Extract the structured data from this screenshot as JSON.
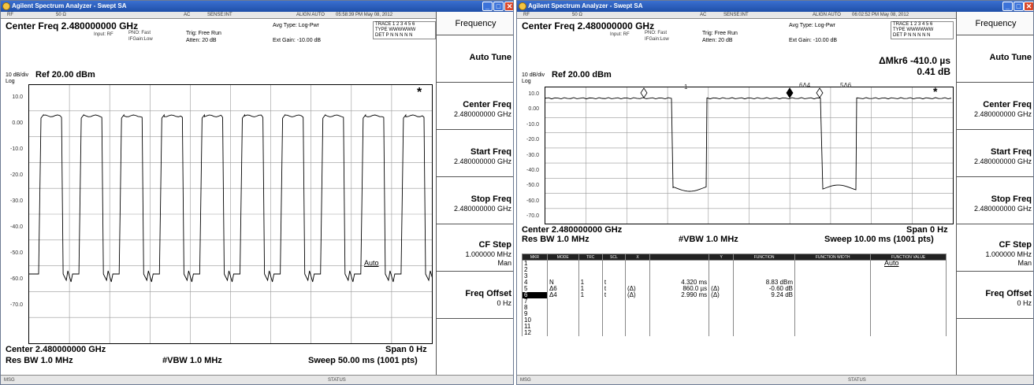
{
  "window_title": "Agilent Spectrum Analyzer - Swept SA",
  "left": {
    "info": {
      "rf": "RF",
      "ohm": "50 Ω",
      "ac": "AC",
      "sense": "SENSE:INT",
      "align": "ALIGN AUTO",
      "time": "05:58:39 PM May 08, 2012"
    },
    "center_freq": "Center Freq  2.480000000 GHz",
    "input": "Input: RF",
    "pno": "PNO: Fast",
    "ifgain": "IFGain:Low",
    "trig": "Trig: Free Run",
    "atten": "Atten: 20 dB",
    "avg_type": "Avg Type: Log-Pwr",
    "ext_gain": "Ext Gain: -10.00 dB",
    "trace_row1": "TRACE 1 2 3 4 5 6",
    "trace_row2": "TYPE WWWWWW",
    "trace_row3": "DET P N N N N N",
    "scale": "10 dB/div",
    "ref": "Ref  20.00 dBm",
    "log": "Log",
    "y_ticks": [
      "10.0",
      "0.00",
      "-10.0",
      "-20.0",
      "-30.0",
      "-40.0",
      "-50.0",
      "-60.0",
      "-70.0"
    ],
    "star": "*",
    "center_bottom": "Center 2.480000000 GHz",
    "span": "Span 0 Hz",
    "res_bw": "Res BW  1.0 MHz",
    "vbw": "#VBW  1.0 MHz",
    "sweep": "Sweep  50.00 ms (1001 pts)",
    "status_msg": "MSG",
    "status": "STATUS",
    "softkeys": {
      "header": "Frequency",
      "auto_tune": "Auto Tune",
      "center_freq": "Center Freq",
      "center_freq_val": "2.480000000 GHz",
      "start_freq": "Start Freq",
      "start_freq_val": "2.480000000 GHz",
      "stop_freq": "Stop Freq",
      "stop_freq_val": "2.480000000 GHz",
      "cf_step": "CF Step",
      "cf_step_val": "1.000000 MHz",
      "auto": "Auto",
      "man": "Man",
      "freq_offset": "Freq Offset",
      "freq_offset_val": "0 Hz"
    }
  },
  "right": {
    "info": {
      "rf": "RF",
      "ohm": "50 Ω",
      "ac": "AC",
      "sense": "SENSE:INT",
      "align": "ALIGN AUTO",
      "time": "06:02:52 PM May 08, 2012"
    },
    "center_freq": "Center Freq  2.480000000 GHz",
    "input": "Input: RF",
    "pno": "PNO: Fast",
    "ifgain": "IFGain:Low",
    "trig": "Trig: Free Run",
    "atten": "Atten: 20 dB",
    "avg_type": "Avg Type: Log-Pwr",
    "ext_gain": "Ext Gain: -10.00 dB",
    "trace_row1": "TRACE 1 2 3 4 5 6",
    "trace_row2": "TYPE WWWWWW",
    "trace_row3": "DET P N N N N N",
    "delta_mkr": "ΔMkr6  -410.0 µs",
    "delta_val": "0.41 dB",
    "scale": "10 dB/div",
    "ref": "Ref  20.00 dBm",
    "log": "Log",
    "y_ticks": [
      "10.0",
      "0.00",
      "-10.0",
      "-20.0",
      "-30.0",
      "-40.0",
      "-50.0",
      "-60.0",
      "-70.0"
    ],
    "markers": {
      "m1": "1",
      "m6d4": "6Δ4",
      "m5d6": "5Δ6"
    },
    "star": "*",
    "center_bottom": "Center 2.480000000 GHz",
    "span": "Span 0 Hz",
    "res_bw": "Res BW  1.0 MHz",
    "vbw": "#VBW  1.0 MHz",
    "sweep": "Sweep  10.00 ms (1001 pts)",
    "table_headers": [
      "MKR",
      "MODE",
      "TRC",
      "SCL",
      "X",
      "",
      "Y",
      "FUNCTION",
      "FUNCTION WIDTH",
      "FUNCTION VALUE"
    ],
    "table_rows": [
      [
        "1",
        "",
        "",
        "",
        "",
        "",
        "",
        "",
        "",
        ""
      ],
      [
        "2",
        "",
        "",
        "",
        "",
        "",
        "",
        "",
        "",
        ""
      ],
      [
        "3",
        "",
        "",
        "",
        "",
        "",
        "",
        "",
        "",
        ""
      ],
      [
        "4",
        "N",
        "1",
        "t",
        "",
        "4.320 ms",
        "",
        "8.83 dBm",
        "",
        ""
      ],
      [
        "5",
        "Δ6",
        "1",
        "t",
        "(Δ)",
        "860.0 µs",
        "(Δ)",
        "-0.60 dB",
        "",
        ""
      ],
      [
        "6",
        "Δ4",
        "1",
        "t",
        "(Δ)",
        "2.990 ms",
        "(Δ)",
        "9.24 dB",
        "",
        ""
      ],
      [
        "7",
        "",
        "",
        "",
        "",
        "",
        "",
        "",
        "",
        ""
      ],
      [
        "8",
        "",
        "",
        "",
        "",
        "",
        "",
        "",
        "",
        ""
      ],
      [
        "9",
        "",
        "",
        "",
        "",
        "",
        "",
        "",
        "",
        ""
      ],
      [
        "10",
        "",
        "",
        "",
        "",
        "",
        "",
        "",
        "",
        ""
      ],
      [
        "11",
        "",
        "",
        "",
        "",
        "",
        "",
        "",
        "",
        ""
      ],
      [
        "12",
        "",
        "",
        "",
        "",
        "",
        "",
        "",
        "",
        ""
      ]
    ],
    "status_msg": "MSG",
    "status": "STATUS",
    "softkeys": {
      "header": "Frequency",
      "auto_tune": "Auto Tune",
      "center_freq": "Center Freq",
      "center_freq_val": "2.480000000 GHz",
      "start_freq": "Start Freq",
      "start_freq_val": "2.480000000 GHz",
      "stop_freq": "Stop Freq",
      "stop_freq_val": "2.480000000 GHz",
      "cf_step": "CF Step",
      "cf_step_val": "1.000000 MHz",
      "auto": "Auto",
      "man": "Man",
      "freq_offset": "Freq Offset",
      "freq_offset_val": "0 Hz"
    }
  },
  "colors": {
    "titlebar": "#2b5fc4",
    "trace": "#000000",
    "close_button": "#d9482c"
  }
}
